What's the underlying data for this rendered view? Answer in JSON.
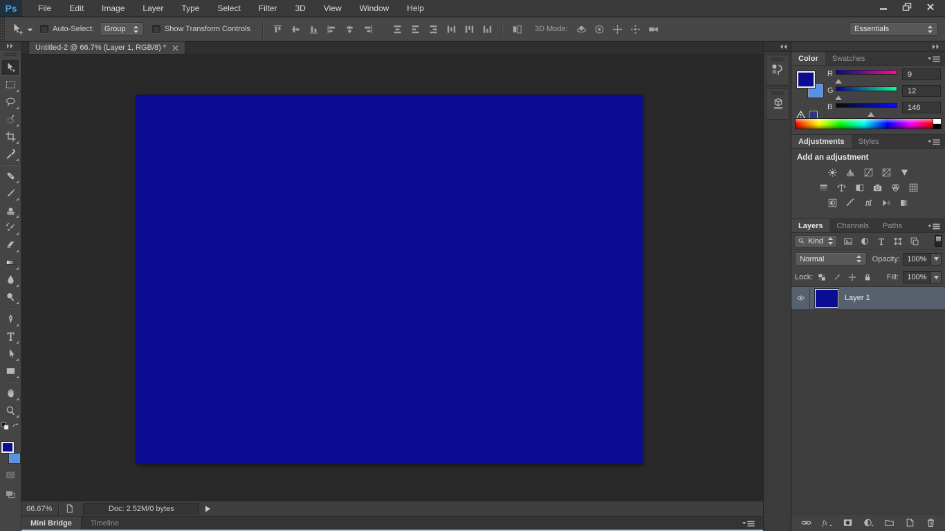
{
  "app": {
    "logo_text": "Ps"
  },
  "menu_bar": {
    "items": [
      "File",
      "Edit",
      "Image",
      "Layer",
      "Type",
      "Select",
      "Filter",
      "3D",
      "View",
      "Window",
      "Help"
    ]
  },
  "window_controls": [
    "minimize",
    "restore",
    "close"
  ],
  "options_bar": {
    "tool_icon": "move-tool",
    "auto_select": {
      "label": "Auto-Select:",
      "checked": false
    },
    "group_select": {
      "value": "Group"
    },
    "show_transform": {
      "label": "Show Transform Controls",
      "checked": false
    },
    "align_icons": [
      "align-top-edges",
      "align-vertical-centers",
      "align-bottom-edges",
      "align-left-edges",
      "align-horizontal-centers",
      "align-right-edges"
    ],
    "distribute_icons": [
      "distribute-top-edges",
      "distribute-vertical-centers",
      "distribute-bottom-edges",
      "distribute-left-edges",
      "distribute-horizontal-centers",
      "distribute-right-edges"
    ],
    "auto_align_icon": "auto-align-layers",
    "mode_label": "3D Mode:",
    "mode_icons": [
      "3d-rotate",
      "3d-roll",
      "3d-drag",
      "3d-slide",
      "3d-camera"
    ],
    "workspace_select": {
      "value": "Essentials"
    }
  },
  "document_tab": {
    "title": "Untitled-2 @ 66.7% (Layer 1, RGB/8) *"
  },
  "tool_palette": {
    "tools": [
      {
        "icon": "move-tool",
        "selected": true,
        "flyout": false
      },
      {
        "icon": "rectangular-marquee-tool"
      },
      {
        "icon": "lasso-tool"
      },
      {
        "icon": "quick-selection-tool"
      },
      {
        "icon": "crop-tool"
      },
      {
        "icon": "eyedropper-tool"
      },
      {
        "sep": true
      },
      {
        "icon": "spot-healing-brush-tool"
      },
      {
        "icon": "brush-tool"
      },
      {
        "icon": "clone-stamp-tool"
      },
      {
        "icon": "history-brush-tool"
      },
      {
        "icon": "eraser-tool"
      },
      {
        "icon": "gradient-tool"
      },
      {
        "icon": "blur-tool"
      },
      {
        "icon": "dodge-tool"
      },
      {
        "sep": true
      },
      {
        "icon": "pen-tool"
      },
      {
        "icon": "type-tool"
      },
      {
        "icon": "path-selection-tool"
      },
      {
        "icon": "rectangle-tool"
      },
      {
        "sep": true
      },
      {
        "icon": "hand-tool"
      },
      {
        "icon": "zoom-tool"
      }
    ]
  },
  "colors": {
    "foreground": "#0a0d92",
    "background": "#5693e8",
    "document_fill": "#0a0d92",
    "workspace_bg": "#292929"
  },
  "color_panel": {
    "tabs": [
      "Color",
      "Swatches"
    ],
    "active_tab": "Color",
    "sliders": [
      {
        "channel": "R",
        "value": "9",
        "position": 4
      },
      {
        "channel": "G",
        "value": "12",
        "position": 5
      },
      {
        "channel": "B",
        "value": "146",
        "position": 57
      }
    ]
  },
  "adjustments_panel": {
    "tabs": [
      "Adjustments",
      "Styles"
    ],
    "active_tab": "Adjustments",
    "heading": "Add an adjustment",
    "icon_rows": [
      [
        "brightness-contrast",
        "levels",
        "curves",
        "exposure",
        "vibrance"
      ],
      [
        "hue-saturation",
        "color-balance",
        "black-white",
        "photo-filter",
        "channel-mixer",
        "color-lookup"
      ],
      [
        "invert",
        "posterize",
        "threshold",
        "gradient-map",
        "selective-color"
      ]
    ]
  },
  "layers_panel": {
    "tabs": [
      "Layers",
      "Channels",
      "Paths"
    ],
    "active_tab": "Layers",
    "kind_filter": {
      "value": "Kind"
    },
    "filter_icons": [
      "pixel-layer-filter",
      "adjustment-layer-filter",
      "type-layer-filter",
      "shape-layer-filter",
      "smart-object-filter"
    ],
    "blend_mode": {
      "value": "Normal"
    },
    "opacity": {
      "label": "Opacity:",
      "value": "100%"
    },
    "lock": {
      "label": "Lock:",
      "icons": [
        "lock-transparency",
        "lock-image",
        "lock-position",
        "lock-all"
      ]
    },
    "fill": {
      "label": "Fill:",
      "value": "100%"
    },
    "layers": [
      {
        "name": "Layer 1",
        "visible": true,
        "selected": true
      }
    ],
    "bottom_icons": [
      "link-layers",
      "layer-style-fx",
      "add-layer-mask",
      "new-adjustment-layer",
      "new-group",
      "new-layer",
      "delete-layer"
    ]
  },
  "collapsed_dock": {
    "buttons": [
      "history-panel",
      "threed-panel"
    ]
  },
  "status_bar": {
    "zoom": "66.67%",
    "doc_info": "Doc: 2.52M/0 bytes"
  },
  "bottom_tabs": {
    "tabs": [
      "Mini Bridge",
      "Timeline"
    ],
    "active_tab": "Mini Bridge"
  }
}
